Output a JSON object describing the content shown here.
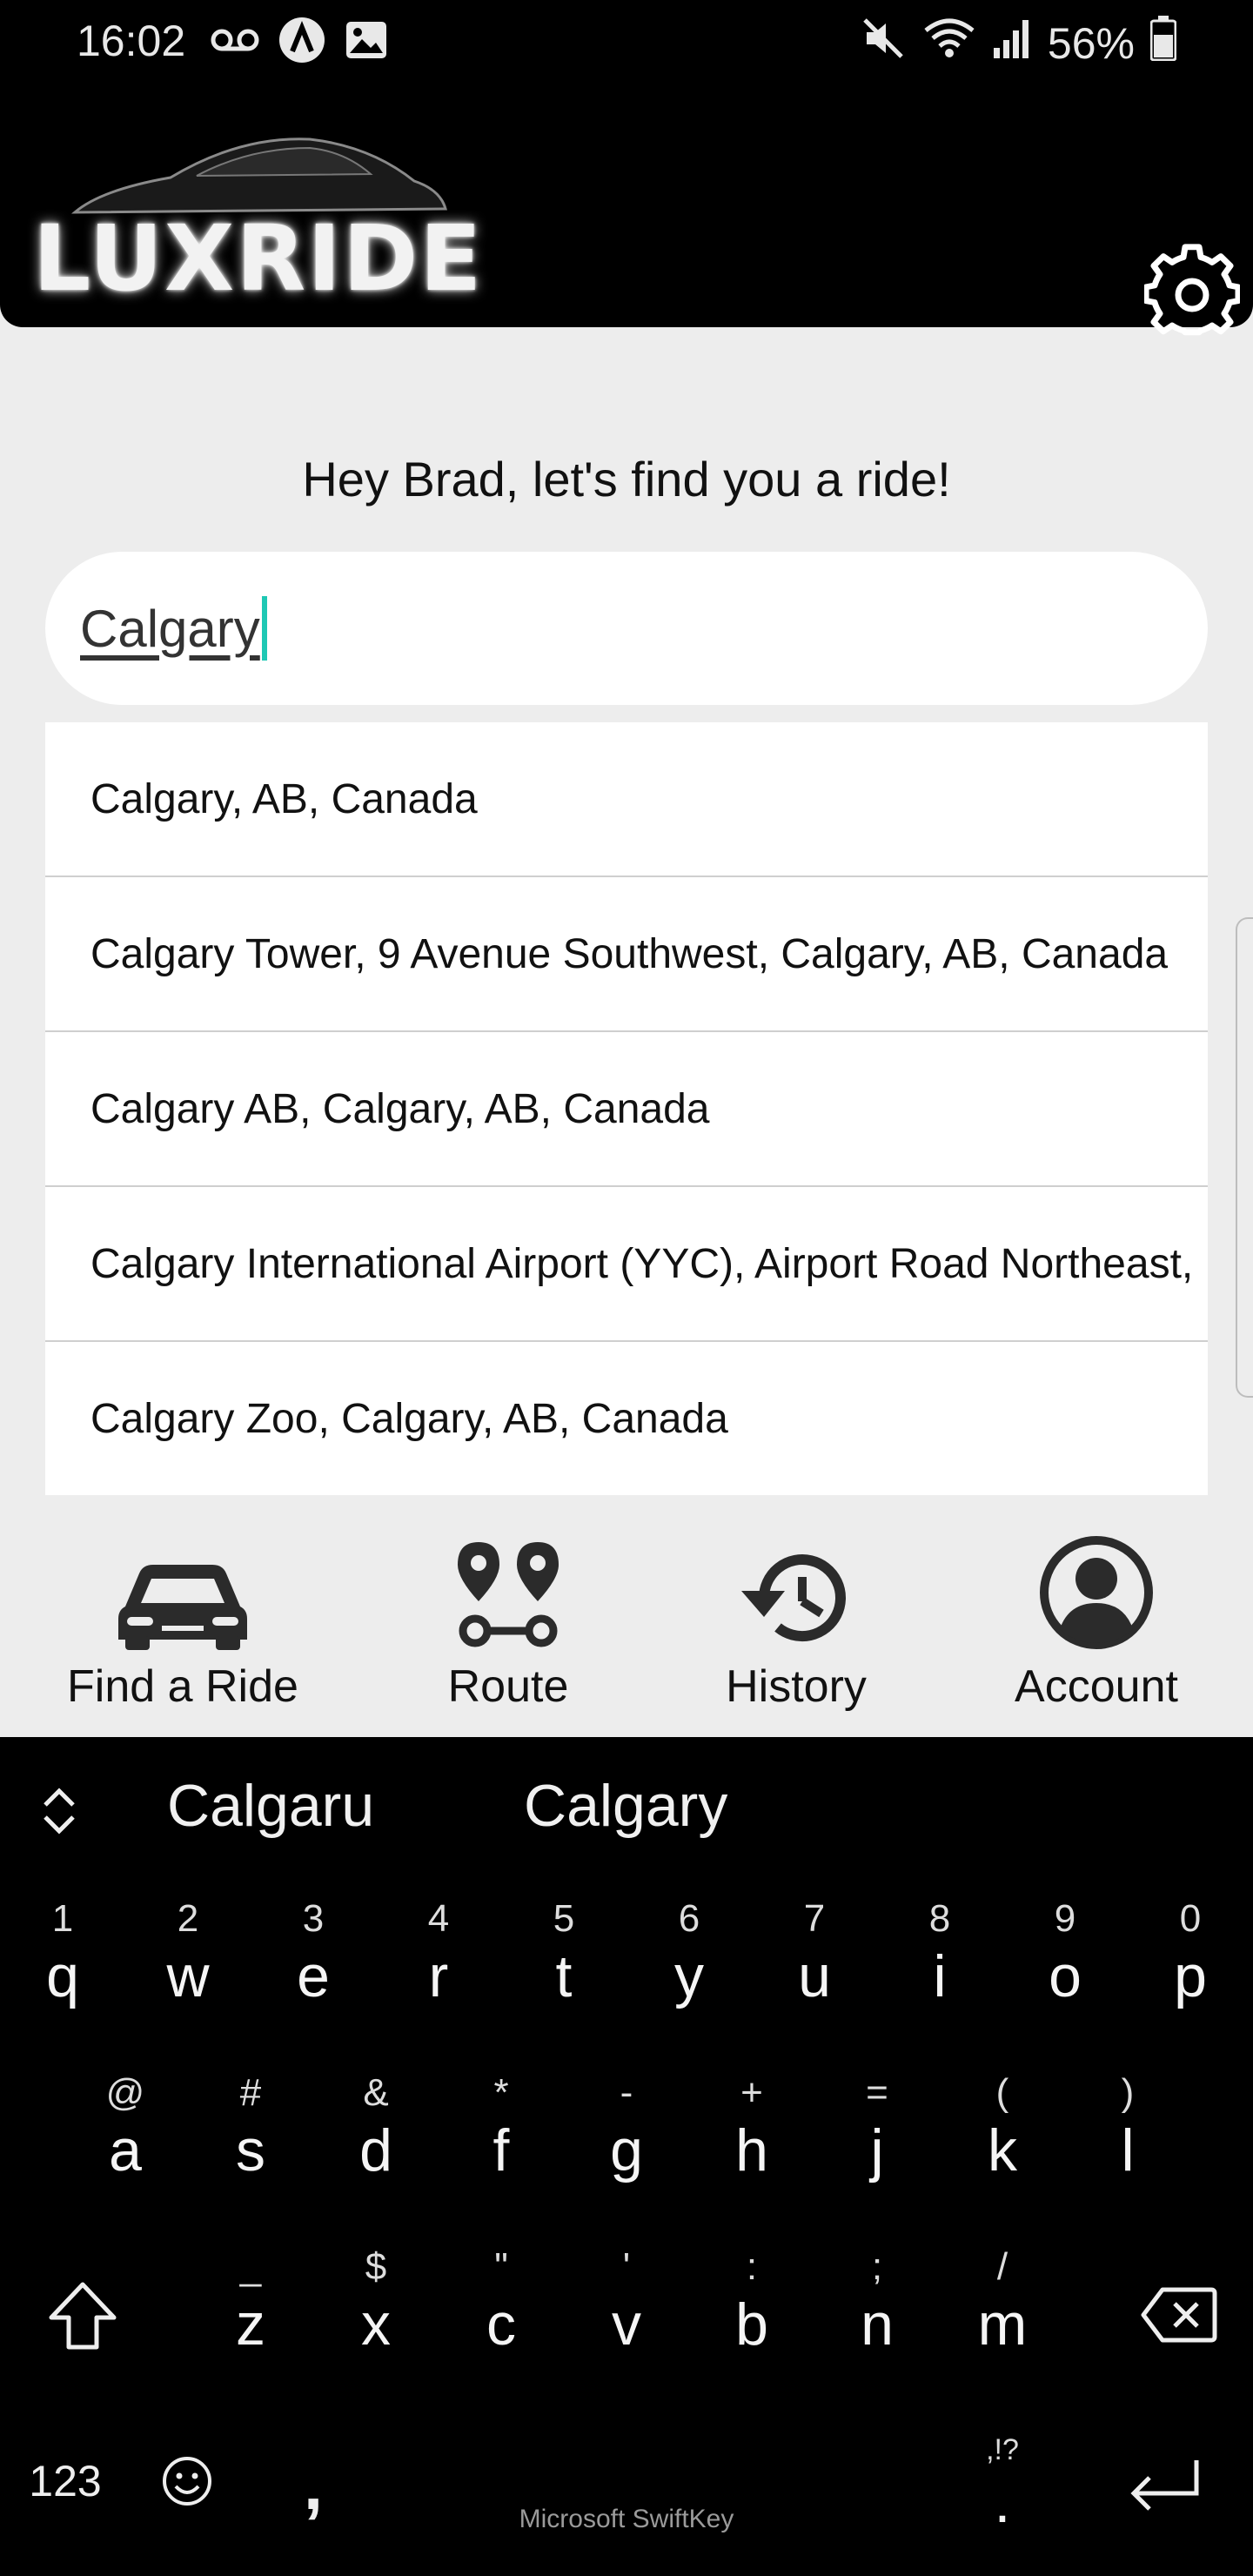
{
  "status_bar": {
    "time": "16:02",
    "battery": "56%",
    "icons": [
      "voicemail-icon",
      "app-a-icon",
      "image-icon",
      "mute-icon",
      "wifi-icon",
      "signal-icon",
      "battery-icon"
    ]
  },
  "header": {
    "logo_text": "LUXRIDE",
    "settings_icon": "gear-icon"
  },
  "main": {
    "greeting": "Hey Brad, let's find you a ride!",
    "search": {
      "value": "Calgary",
      "accent_color": "#1ec8b4"
    },
    "suggestions": [
      "Calgary, AB, Canada",
      "Calgary Tower, 9 Avenue Southwest, Calgary, AB, Canada",
      "Calgary AB, Calgary, AB, Canada",
      "Calgary International Airport (YYC), Airport Road Northeast,",
      "Calgary Zoo, Calgary, AB, Canada"
    ]
  },
  "nav": {
    "items": [
      {
        "label": "Find a Ride",
        "icon": "car-icon"
      },
      {
        "label": "Route",
        "icon": "route-icon"
      },
      {
        "label": "History",
        "icon": "history-icon"
      },
      {
        "label": "Account",
        "icon": "account-icon"
      }
    ]
  },
  "keyboard": {
    "suggestions": [
      "Calgaru",
      "Calgary"
    ],
    "row1": [
      {
        "hint": "1",
        "key": "q"
      },
      {
        "hint": "2",
        "key": "w"
      },
      {
        "hint": "3",
        "key": "e"
      },
      {
        "hint": "4",
        "key": "r"
      },
      {
        "hint": "5",
        "key": "t"
      },
      {
        "hint": "6",
        "key": "y"
      },
      {
        "hint": "7",
        "key": "u"
      },
      {
        "hint": "8",
        "key": "i"
      },
      {
        "hint": "9",
        "key": "o"
      },
      {
        "hint": "0",
        "key": "p"
      }
    ],
    "row2": [
      {
        "hint": "@",
        "key": "a"
      },
      {
        "hint": "#",
        "key": "s"
      },
      {
        "hint": "&",
        "key": "d"
      },
      {
        "hint": "*",
        "key": "f"
      },
      {
        "hint": "-",
        "key": "g"
      },
      {
        "hint": "+",
        "key": "h"
      },
      {
        "hint": "=",
        "key": "j"
      },
      {
        "hint": "(",
        "key": "k"
      },
      {
        "hint": ")",
        "key": "l"
      }
    ],
    "row3": [
      {
        "hint": "_",
        "key": "z"
      },
      {
        "hint": "$",
        "key": "x"
      },
      {
        "hint": "\"",
        "key": "c"
      },
      {
        "hint": "'",
        "key": "v"
      },
      {
        "hint": ":",
        "key": "b"
      },
      {
        "hint": ";",
        "key": "n"
      },
      {
        "hint": "/",
        "key": "m"
      }
    ],
    "numbers_label": "123",
    "comma": ",",
    "period_hint": ",!?",
    "period": ".",
    "brand": "Microsoft SwiftKey"
  }
}
